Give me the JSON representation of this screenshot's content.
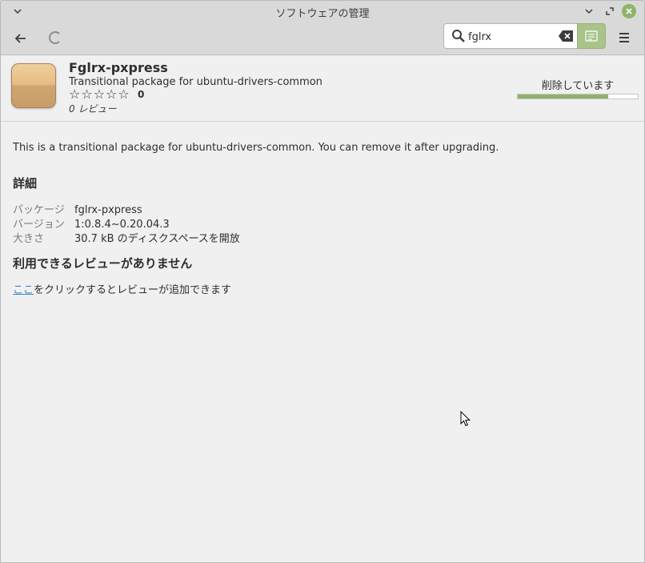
{
  "window": {
    "title": "ソフトウェアの管理"
  },
  "toolbar": {
    "search_value": "fglrx"
  },
  "app": {
    "name": "Fglrx-pxpress",
    "summary": "Transitional package for ubuntu-drivers-common",
    "rating_count": "0",
    "reviews_label": "0 レビュー",
    "stars": 0,
    "status_label": "削除しています",
    "progress": 0.75,
    "description": "This is a transitional package for ubuntu-drivers-common. You can remove it after upgrading."
  },
  "details": {
    "title": "詳細",
    "rows": [
      {
        "key": "パッケージ",
        "value": "fglrx-pxpress"
      },
      {
        "key": "バージョン",
        "value": "1:0.8.4~0.20.04.3"
      },
      {
        "key": "大きさ",
        "value": "30.7 kB のディスクスペースを開放"
      }
    ]
  },
  "reviews": {
    "title": "利用できるレビューがありません",
    "link_text": "ここ",
    "link_suffix": "をクリックするとレビューが追加できます"
  },
  "colors": {
    "accent": "#8fb36a",
    "link": "#3d83c7"
  }
}
